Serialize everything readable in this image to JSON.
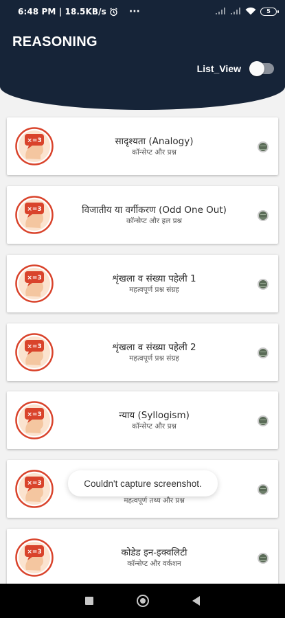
{
  "status_bar": {
    "time_speed": "6:48 PM | 18.5KB/s",
    "more": "···",
    "battery": "5"
  },
  "header": {
    "title": "REASONING",
    "list_view_label": "List_View",
    "list_view_enabled": false
  },
  "items": [
    {
      "title": "सादृश्यता (Analogy)",
      "subtitle": "कॉन्सेप्ट और प्रश्न"
    },
    {
      "title": "विजातीय या वर्गीकरण (Odd One Out)",
      "subtitle": "कॉन्सेप्ट और हल प्रश्न"
    },
    {
      "title": "शृंखला व संख्या पहेली 1",
      "subtitle": "महत्वपूर्ण प्रश्न संग्रह"
    },
    {
      "title": "शृंखला व संख्या पहेली 2",
      "subtitle": "महत्वपूर्ण प्रश्न संग्रह"
    },
    {
      "title": "न्याय (Syllogism)",
      "subtitle": "कॉन्सेप्ट और प्रश्न"
    },
    {
      "title": "",
      "subtitle": "महत्वपूर्ण तथ्य और प्रश्न"
    },
    {
      "title": "कोडेड इन-इक्वलिटी",
      "subtitle": "कॉन्सेप्ट और वर्कशन"
    }
  ],
  "toast": {
    "message": "Couldn't capture screenshot."
  },
  "icon_badge_text": "×=3"
}
